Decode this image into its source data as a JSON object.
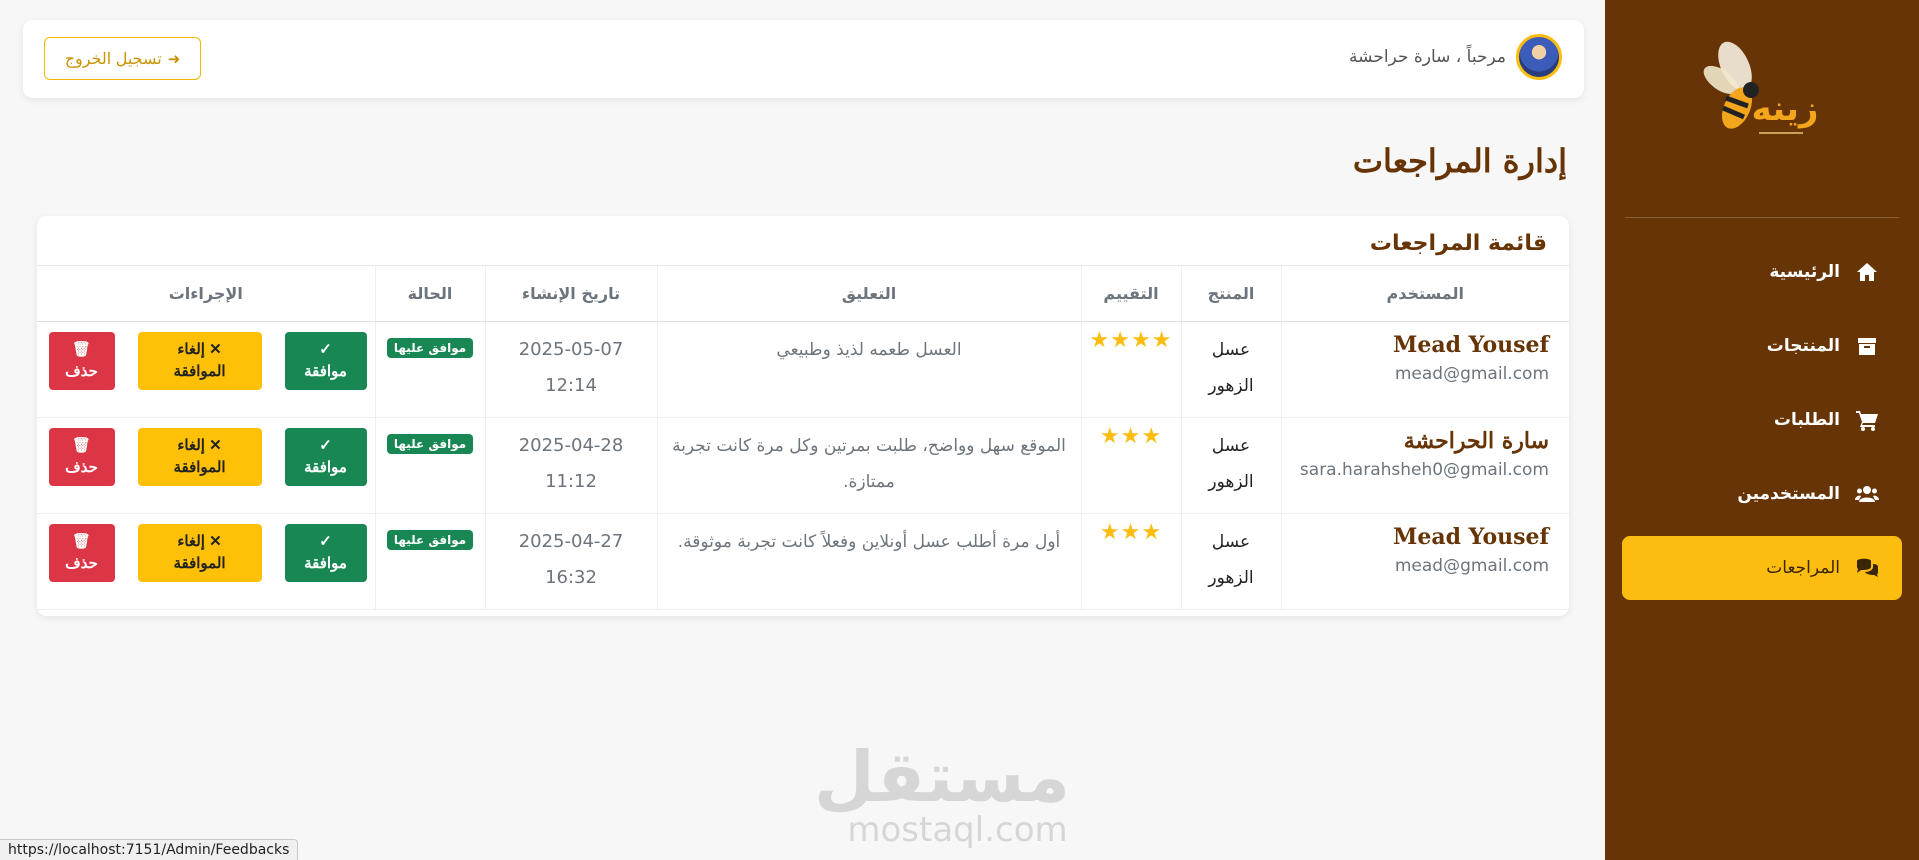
{
  "sidebar": {
    "items": [
      {
        "label": "الرئيسية",
        "icon": "home-icon"
      },
      {
        "label": "المنتجات",
        "icon": "box-icon"
      },
      {
        "label": "الطلبات",
        "icon": "cart-icon"
      },
      {
        "label": "المستخدمين",
        "icon": "users-icon"
      },
      {
        "label": "المراجعات",
        "icon": "comments-icon",
        "active": true
      }
    ],
    "logo_text": "زينه",
    "bg_color": "#673405",
    "active_color": "#fdbd10"
  },
  "header": {
    "greeting": "مرحباً ، سارة حراحشة",
    "logout_label": "تسجيل الخروج"
  },
  "page": {
    "title": "إدارة المراجعات"
  },
  "reviews": {
    "card_title": "قائمة المراجعات",
    "columns": [
      "المستخدم",
      "المنتج",
      "التقييم",
      "التعليق",
      "تاريخ الإنشاء",
      "الحالة",
      "الإجراءات"
    ],
    "rows": [
      {
        "user_name": "Mead Yousef",
        "user_email": "mead@gmail.com",
        "product_line1": "عسل",
        "product_line2": "الزهور",
        "stars": "★★★★",
        "rating": 4,
        "comment": "العسل طعمه لذيذ وطبيعي",
        "date": "2025-05-07",
        "time": "12:14",
        "status": "موافق عليها"
      },
      {
        "user_name": "سارة الحراحشة",
        "user_email": "sara.harahsheh0@gmail.com",
        "product_line1": "عسل",
        "product_line2": "الزهور",
        "stars": "★★★",
        "rating": 3,
        "comment": "الموقع سهل وواضح، طلبت بمرتين وكل مرة كانت تجربة ممتازة.",
        "date": "2025-04-28",
        "time": "11:12",
        "status": "موافق عليها"
      },
      {
        "user_name": "Mead Yousef",
        "user_email": "mead@gmail.com",
        "product_line1": "عسل",
        "product_line2": "الزهور",
        "stars": "★★★",
        "rating": 3,
        "comment": "أول مرة أطلب عسل أونلاين وفعلاً كانت تجربة موثوقة.",
        "date": "2025-04-27",
        "time": "16:32",
        "status": "موافق عليها"
      }
    ],
    "actions": {
      "approve_icon": "✓",
      "approve_label": "موافقة",
      "cancel_line1": "✕ إلغاء",
      "cancel_line2": "الموافقة",
      "delete_label": "حذف"
    }
  },
  "watermark": {
    "arabic": "مستقل",
    "latin": "mostaql.com"
  },
  "status_bar": {
    "url": "https://localhost:7151/Admin/Feedbacks"
  }
}
